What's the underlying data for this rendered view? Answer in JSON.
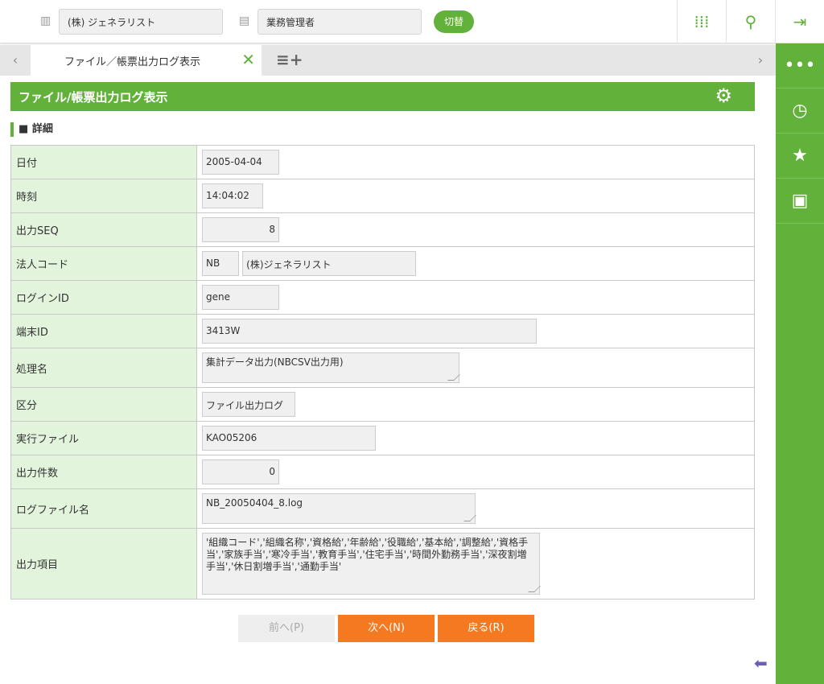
{
  "header": {
    "company": "(株) ジェネラリスト",
    "role": "業務管理者",
    "switch_label": "切替"
  },
  "tabs": [
    {
      "label": "ファイル／帳票出力ログ表示"
    }
  ],
  "page_title": "ファイル/帳票出力ログ表示",
  "section_title": "詳細",
  "fields": {
    "date": {
      "label": "日付",
      "value": "2005-04-04"
    },
    "time": {
      "label": "時刻",
      "value": "14:04:02"
    },
    "seq": {
      "label": "出力SEQ",
      "value": "8"
    },
    "corp": {
      "label": "法人コード",
      "code": "NB",
      "name": "(株)ジェネラリスト"
    },
    "login": {
      "label": "ログインID",
      "value": "gene"
    },
    "terminal": {
      "label": "端末ID",
      "value": "3413W"
    },
    "process": {
      "label": "処理名",
      "value": "集計データ出力(NBCSV出力用)"
    },
    "category": {
      "label": "区分",
      "value": "ファイル出力ログ"
    },
    "exec_file": {
      "label": "実行ファイル",
      "value": "KAO05206"
    },
    "count": {
      "label": "出力件数",
      "value": "0"
    },
    "logfile": {
      "label": "ログファイル名",
      "value": "NB_20050404_8.log"
    },
    "items": {
      "label": "出力項目",
      "value": "'組織コード','組織名称','資格給','年齢給','役職給','基本給','調整給','資格手当','家族手当','寒冷手当','教育手当','住宅手当','時間外勤務手当','深夜割増手当','休日割増手当','通勤手当'"
    }
  },
  "buttons": {
    "prev": "前へ(P)",
    "next": "次へ(N)",
    "back": "戻る(R)"
  }
}
